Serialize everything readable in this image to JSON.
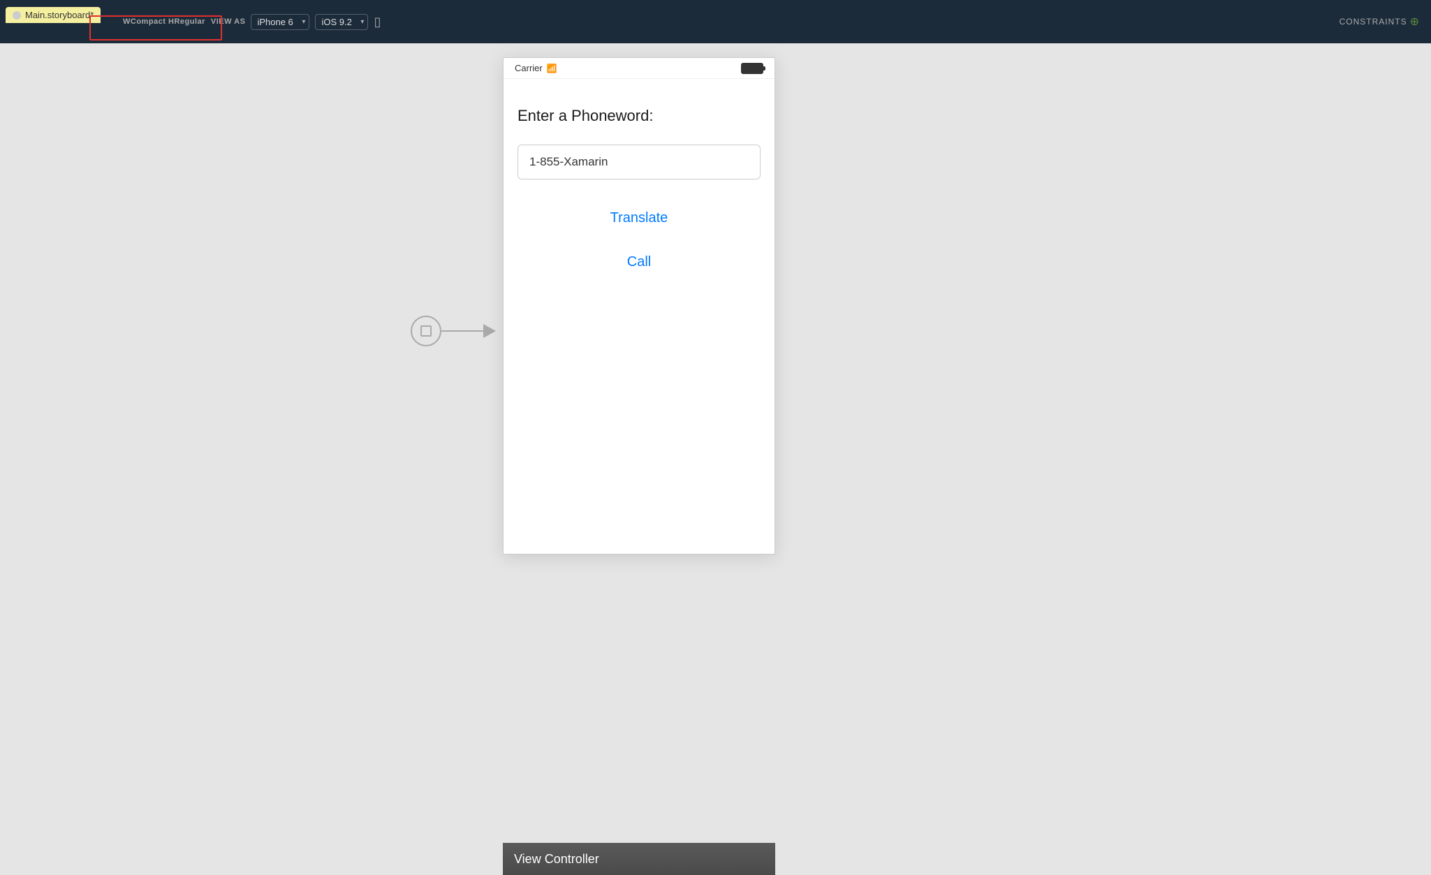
{
  "topbar": {
    "file_tab_label": "Main.storyboard*",
    "view_as_label": "VIEW AS",
    "device_label": "iPhone 6",
    "ios_label": "iOS 9.2",
    "size_class_label": "WCompact HRegular",
    "constraints_label": "CONSTRAINTS"
  },
  "segue": {
    "arrow_description": "segue arrow"
  },
  "iphone": {
    "status": {
      "carrier": "Carrier",
      "signal": "wifi"
    },
    "content": {
      "enter_label": "Enter a Phoneword:",
      "input_value": "1-855-Xamarin",
      "translate_btn": "Translate",
      "call_btn": "Call"
    },
    "view_controller_label": "View Controller"
  },
  "colors": {
    "accent_blue": "#007AFF",
    "top_bar_bg": "#1c2b3a",
    "canvas_bg": "#e5e5e5",
    "highlight_red": "#e03030",
    "file_tab_yellow": "#f5f0a0"
  }
}
